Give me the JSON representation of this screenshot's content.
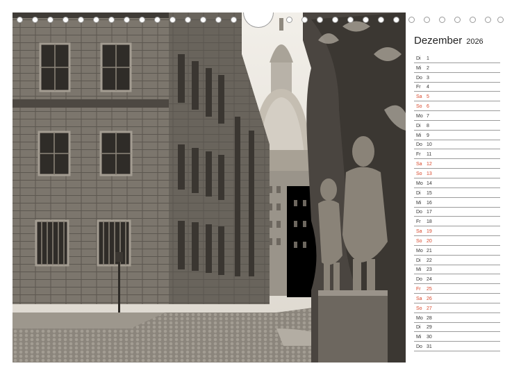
{
  "calendar": {
    "month": "Dezember",
    "year": "2026",
    "weekend_color": "#d8472a",
    "days": [
      {
        "wd": "Di",
        "d": "1",
        "we": false
      },
      {
        "wd": "Mi",
        "d": "2",
        "we": false
      },
      {
        "wd": "Do",
        "d": "3",
        "we": false
      },
      {
        "wd": "Fr",
        "d": "4",
        "we": false
      },
      {
        "wd": "Sa",
        "d": "5",
        "we": true
      },
      {
        "wd": "So",
        "d": "6",
        "we": true
      },
      {
        "wd": "Mo",
        "d": "7",
        "we": false
      },
      {
        "wd": "Di",
        "d": "8",
        "we": false
      },
      {
        "wd": "Mi",
        "d": "9",
        "we": false
      },
      {
        "wd": "Do",
        "d": "10",
        "we": false
      },
      {
        "wd": "Fr",
        "d": "11",
        "we": false
      },
      {
        "wd": "Sa",
        "d": "12",
        "we": true
      },
      {
        "wd": "So",
        "d": "13",
        "we": true
      },
      {
        "wd": "Mo",
        "d": "14",
        "we": false
      },
      {
        "wd": "Di",
        "d": "15",
        "we": false
      },
      {
        "wd": "Mi",
        "d": "16",
        "we": false
      },
      {
        "wd": "Do",
        "d": "17",
        "we": false
      },
      {
        "wd": "Fr",
        "d": "18",
        "we": false
      },
      {
        "wd": "Sa",
        "d": "19",
        "we": true
      },
      {
        "wd": "So",
        "d": "20",
        "we": true
      },
      {
        "wd": "Mo",
        "d": "21",
        "we": false
      },
      {
        "wd": "Di",
        "d": "22",
        "we": false
      },
      {
        "wd": "Mi",
        "d": "23",
        "we": false
      },
      {
        "wd": "Do",
        "d": "24",
        "we": false
      },
      {
        "wd": "Fr",
        "d": "25",
        "we": true
      },
      {
        "wd": "Sa",
        "d": "26",
        "we": true
      },
      {
        "wd": "So",
        "d": "27",
        "we": true
      },
      {
        "wd": "Mo",
        "d": "28",
        "we": false
      },
      {
        "wd": "Di",
        "d": "29",
        "we": false
      },
      {
        "wd": "Mi",
        "d": "30",
        "we": false
      },
      {
        "wd": "Do",
        "d": "31",
        "we": false
      }
    ]
  },
  "photo": {
    "subject": "sepia street scene with baroque church dome and sculpted portal",
    "tone_dark": "#2e2b27",
    "tone_light": "#e9e5dd"
  }
}
